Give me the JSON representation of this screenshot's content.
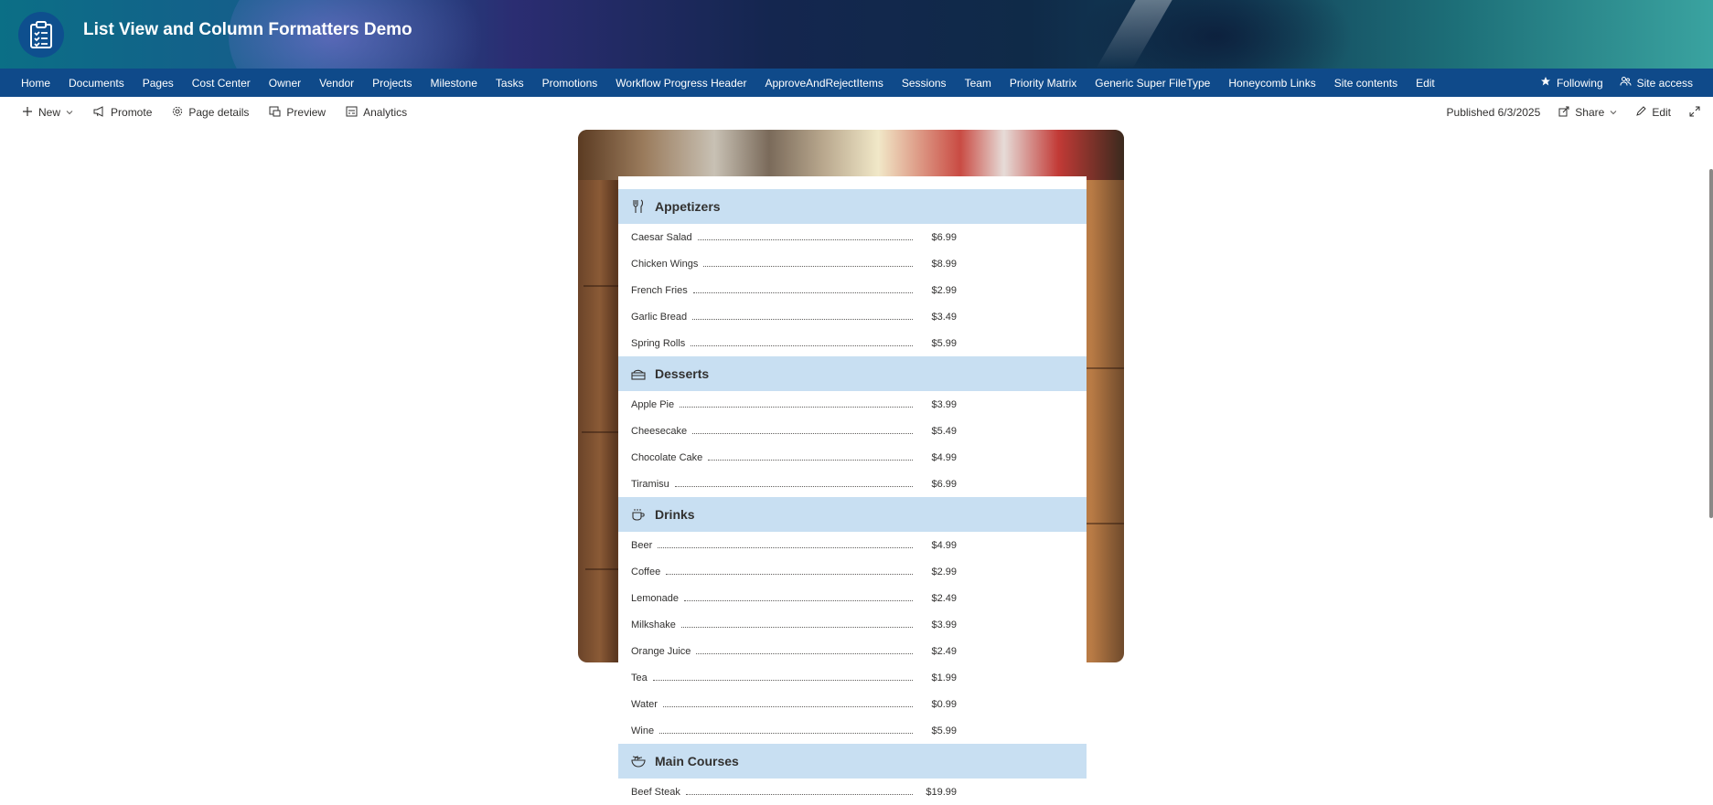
{
  "site": {
    "title": "List View and Column Formatters Demo"
  },
  "nav": {
    "items": [
      "Home",
      "Documents",
      "Pages",
      "Cost Center",
      "Owner",
      "Vendor",
      "Projects",
      "Milestone",
      "Tasks",
      "Promotions",
      "Workflow Progress Header",
      "ApproveAndRejectItems",
      "Sessions",
      "Team",
      "Priority Matrix",
      "Generic Super FileType",
      "Honeycomb Links",
      "Site contents",
      "Edit"
    ],
    "following": "Following",
    "site_access": "Site access"
  },
  "commandbar": {
    "new": "New",
    "promote": "Promote",
    "page_details": "Page details",
    "preview": "Preview",
    "analytics": "Analytics",
    "published": "Published 6/3/2025",
    "share": "Share",
    "edit": "Edit"
  },
  "menu": {
    "sections": [
      {
        "title": "Appetizers",
        "icon": "fork-knife-icon",
        "items": [
          {
            "name": "Caesar Salad",
            "price": "$6.99"
          },
          {
            "name": "Chicken Wings",
            "price": "$8.99"
          },
          {
            "name": "French Fries",
            "price": "$2.99"
          },
          {
            "name": "Garlic Bread",
            "price": "$3.49"
          },
          {
            "name": "Spring Rolls",
            "price": "$5.99"
          }
        ]
      },
      {
        "title": "Desserts",
        "icon": "cake-icon",
        "items": [
          {
            "name": "Apple Pie",
            "price": "$3.99"
          },
          {
            "name": "Cheesecake",
            "price": "$5.49"
          },
          {
            "name": "Chocolate Cake",
            "price": "$4.99"
          },
          {
            "name": "Tiramisu",
            "price": "$6.99"
          }
        ]
      },
      {
        "title": "Drinks",
        "icon": "coffee-cup-icon",
        "items": [
          {
            "name": "Beer",
            "price": "$4.99"
          },
          {
            "name": "Coffee",
            "price": "$2.99"
          },
          {
            "name": "Lemonade",
            "price": "$2.49"
          },
          {
            "name": "Milkshake",
            "price": "$3.99"
          },
          {
            "name": "Orange Juice",
            "price": "$2.49"
          },
          {
            "name": "Tea",
            "price": "$1.99"
          },
          {
            "name": "Water",
            "price": "$0.99"
          },
          {
            "name": "Wine",
            "price": "$5.99"
          }
        ]
      },
      {
        "title": "Main Courses",
        "icon": "noodle-bowl-icon",
        "items": [
          {
            "name": "Beef Steak",
            "price": "$19.99"
          }
        ]
      }
    ]
  },
  "colors": {
    "nav_bg": "#0f4a8a",
    "section_bg": "#c8dff2",
    "logo_bg": "#0e4f8e"
  }
}
